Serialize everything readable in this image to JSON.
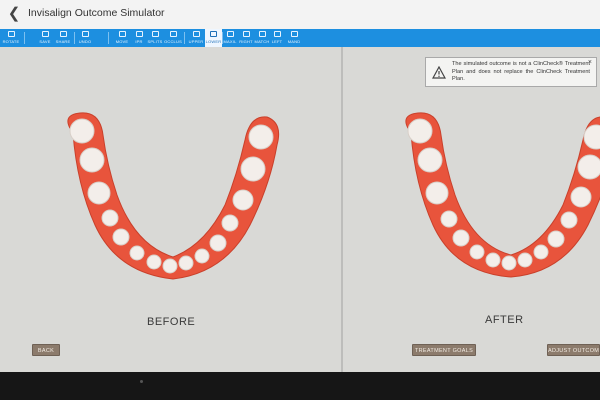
{
  "app": {
    "title": "Invisalign Outcome Simulator",
    "back_icon": "back-arrow-icon"
  },
  "toolbar": {
    "accent": "#1d8fe0",
    "tools": [
      {
        "label": "ROTATE",
        "icon": "rotate-icon",
        "active": false
      },
      {
        "label": "SAVE",
        "icon": "save-icon",
        "active": false
      },
      {
        "label": "SHARE",
        "icon": "share-icon",
        "active": false
      },
      {
        "label": "UNDO",
        "icon": "undo-icon",
        "active": false
      },
      {
        "label": "MOVE",
        "icon": "move-icon",
        "active": false
      },
      {
        "label": "IPR",
        "icon": "ipr-icon",
        "active": false
      },
      {
        "label": "SPLITS",
        "icon": "splits-icon",
        "active": false
      },
      {
        "label": "OCCLUS",
        "icon": "occlusal-icon",
        "active": false
      },
      {
        "label": "UPPER",
        "icon": "upper-arch-icon",
        "active": false
      },
      {
        "label": "LOWER",
        "icon": "lower-arch-icon",
        "active": true
      },
      {
        "label": "MAXIL",
        "icon": "maxilla-icon",
        "active": false
      },
      {
        "label": "RIGHT",
        "icon": "right-view-icon",
        "active": false
      },
      {
        "label": "MATCH",
        "icon": "match-icon",
        "active": false
      },
      {
        "label": "LEFT",
        "icon": "left-view-icon",
        "active": false
      },
      {
        "label": "MAND",
        "icon": "mandible-icon",
        "active": false
      }
    ]
  },
  "panes": {
    "before": {
      "label": "BEFORE",
      "button": "BACK"
    },
    "after": {
      "label": "AFTER",
      "button_goals": "TREATMENT GOALS",
      "button_adjust": "ADJUST OUTCOME"
    }
  },
  "notice": {
    "text": "The simulated outcome is not a ClinCheck® Treatment Plan and does not replace the ClinCheck Treatment Plan.",
    "close": "×"
  },
  "colors": {
    "gum": "#e8543c",
    "tooth": "#f3eeea",
    "background": "#d8d8d5",
    "button": "#8c7b6c"
  }
}
